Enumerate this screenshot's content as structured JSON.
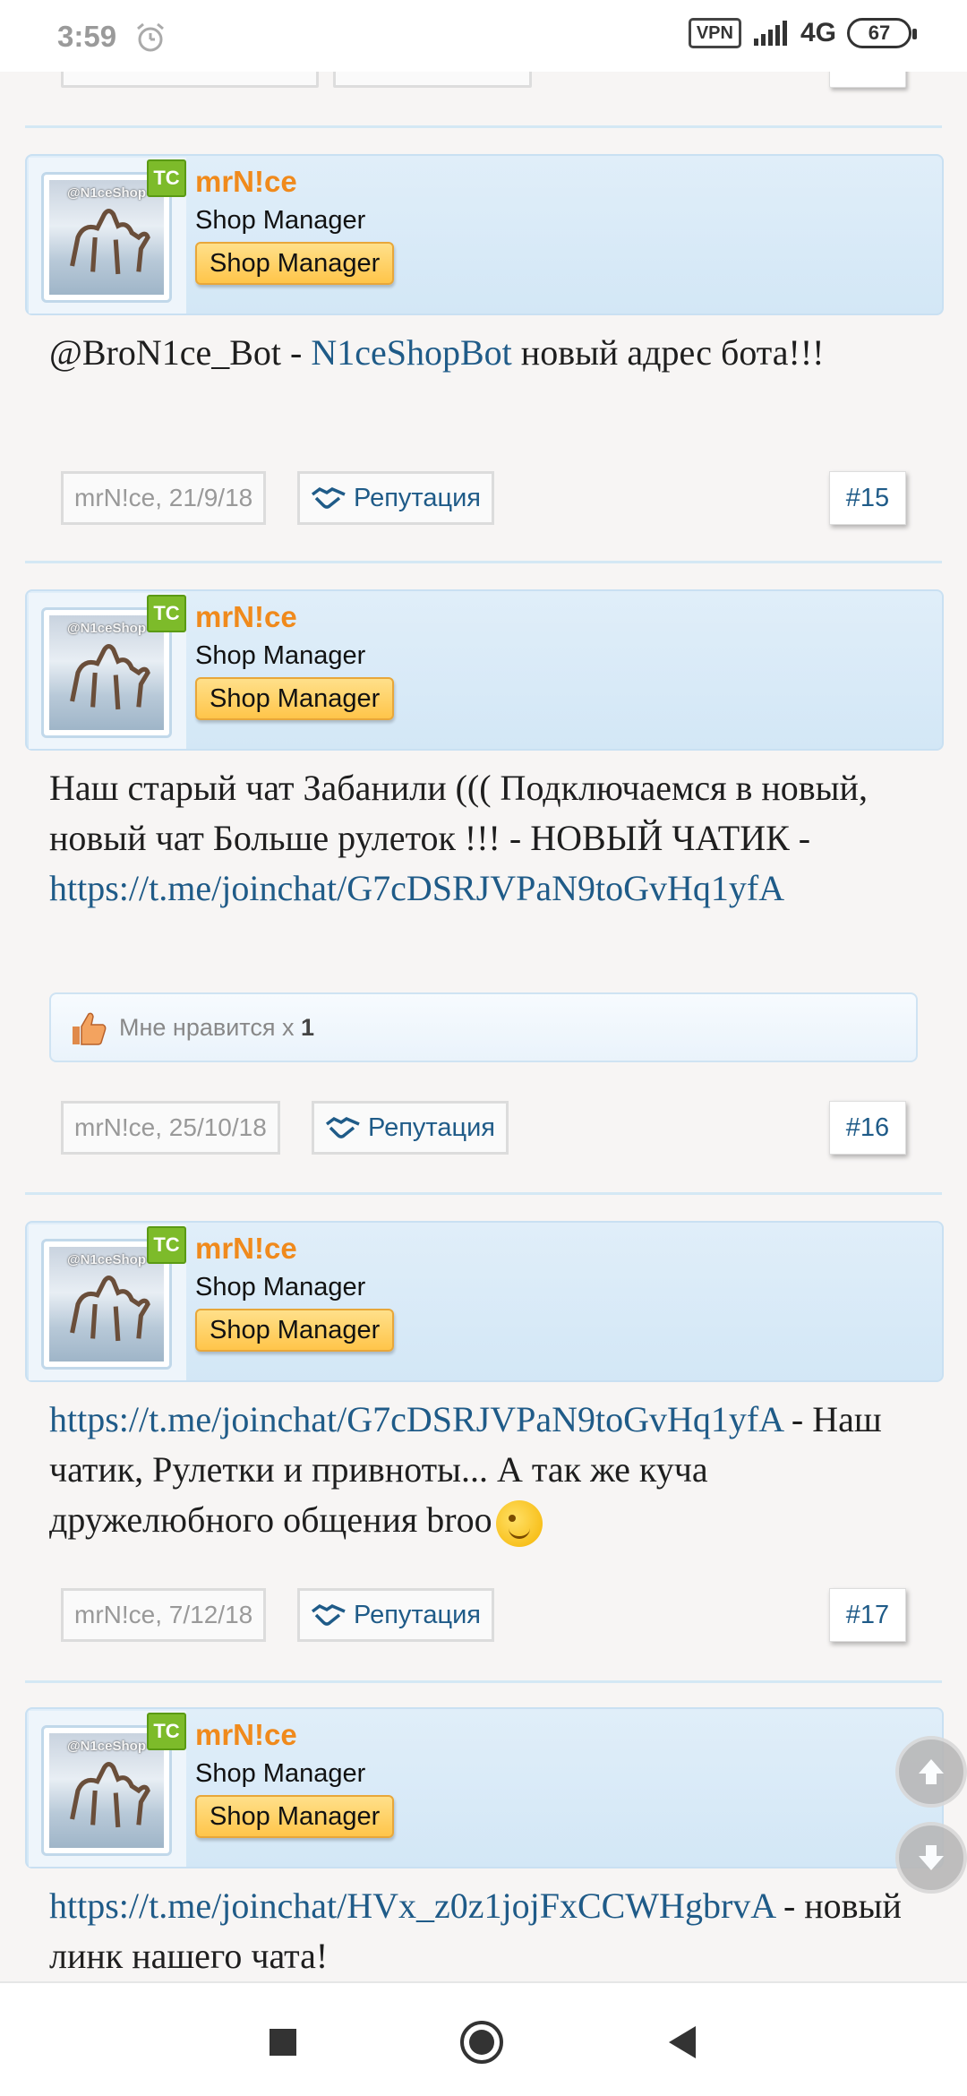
{
  "status_bar": {
    "time": "3:59",
    "vpn": "VPN",
    "network": "4G",
    "battery": "67"
  },
  "posts": [
    {
      "badge": "TC",
      "avatar_text": "@N1ceShop",
      "username": "mrN!ce",
      "user_title": "Shop Manager",
      "user_banner": "Shop Manager",
      "message_pre": "@BroN1ce_Bot - ",
      "message_link": "N1ceShopBot",
      "message_post": " новый адрес бота!!!",
      "author": "mrN!ce",
      "date": ", 21/9/18",
      "reputation": "Репутация",
      "number": "#15"
    },
    {
      "badge": "TC",
      "avatar_text": "@N1ceShop",
      "username": "mrN!ce",
      "user_title": "Shop Manager",
      "user_banner": "Shop Manager",
      "message_pre": "Наш старый чат Забанили ((( Подключаемся в новый, новый чат Больше рулеток !!! - НОВЫЙ ЧАТИК - ",
      "message_link": "https://t.me/joinchat/G7cDSRJVPaN9toGvHq1yfA",
      "message_post": "",
      "likes_prefix": "Мне нравится x ",
      "likes_count": "1",
      "author": "mrN!ce",
      "date": ", 25/10/18",
      "reputation": "Репутация",
      "number": "#16"
    },
    {
      "badge": "TC",
      "avatar_text": "@N1ceShop",
      "username": "mrN!ce",
      "user_title": "Shop Manager",
      "user_banner": "Shop Manager",
      "message_link": "https://t.me/joinchat/G7cDSRJVPaN9toGvHq1yfA",
      "message_post": " - Наш чатик, Рулетки и привноты... А так же куча дружелюбного общения broo",
      "author": "mrN!ce",
      "date": ", 7/12/18",
      "reputation": "Репутация",
      "number": "#17"
    },
    {
      "badge": "TC",
      "avatar_text": "@N1ceShop",
      "username": "mrN!ce",
      "user_title": "Shop Manager",
      "user_banner": "Shop Manager",
      "message_link": "https://t.me/joinchat/HVx_z0z1jojFxCCWHgbrvA",
      "message_post": " - новый линк нашего чата!"
    }
  ],
  "icons": {
    "alarm": "alarm-clock-icon",
    "signal": "signal-icon",
    "reputation": "handshake-icon",
    "like": "thumbs-up-icon",
    "wink": "wink-emoji-icon",
    "scroll_up": "arrow-up-icon",
    "scroll_down": "arrow-down-icon",
    "nav_recent": "square-icon",
    "nav_home": "circle-icon",
    "nav_back": "triangle-back-icon"
  },
  "colors": {
    "username": "#f08a1c",
    "link": "#1f5b88",
    "badge": "#7dbb2a",
    "banner": "#ffc54a"
  }
}
